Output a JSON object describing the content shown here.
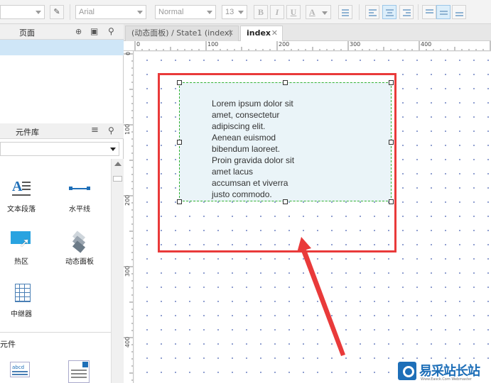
{
  "toolbar": {
    "font_family": "Arial",
    "font_style": "Normal",
    "font_size": "13",
    "bold": "B",
    "italic": "I",
    "underline": "U",
    "font_color": "A"
  },
  "pages_panel": {
    "title": "页面"
  },
  "library_panel": {
    "title": "元件库",
    "widgets": [
      {
        "label": "文本段落",
        "icon": "text-paragraph-icon"
      },
      {
        "label": "水平线",
        "icon": "horizontal-line-icon"
      },
      {
        "label": "热区",
        "icon": "hotspot-icon"
      },
      {
        "label": "动态面板",
        "icon": "dynamic-panel-icon"
      },
      {
        "label": "中继器",
        "icon": "repeater-icon"
      }
    ],
    "section2_label": "元件"
  },
  "tabs": [
    {
      "label": "(动态面板) / State1 (index)",
      "active": false
    },
    {
      "label": "index",
      "active": true
    }
  ],
  "close_glyph": "✕",
  "ruler": {
    "h_labels": [
      "0",
      "100",
      "200",
      "300",
      "400"
    ],
    "v_labels": [
      "0",
      "100",
      "200",
      "300",
      "400"
    ]
  },
  "canvas": {
    "panel_text_lines": [
      "Lorem ipsum dolor sit",
      "amet, consectetur",
      "adipiscing elit.",
      "Aenean euismod",
      "bibendum laoreet.",
      "Proin gravida dolor sit",
      "amet lacus",
      "accumsan et viverra",
      "justo commodo."
    ]
  },
  "colors": {
    "highlight_red": "#e93a3a",
    "selection_green": "#33b233",
    "panel_fill": "#eaf4f8",
    "accent_blue": "#1e6fb8"
  },
  "watermark": {
    "text": "易采站长站",
    "subtext": "Www.Easck.Com  Webmaster"
  }
}
